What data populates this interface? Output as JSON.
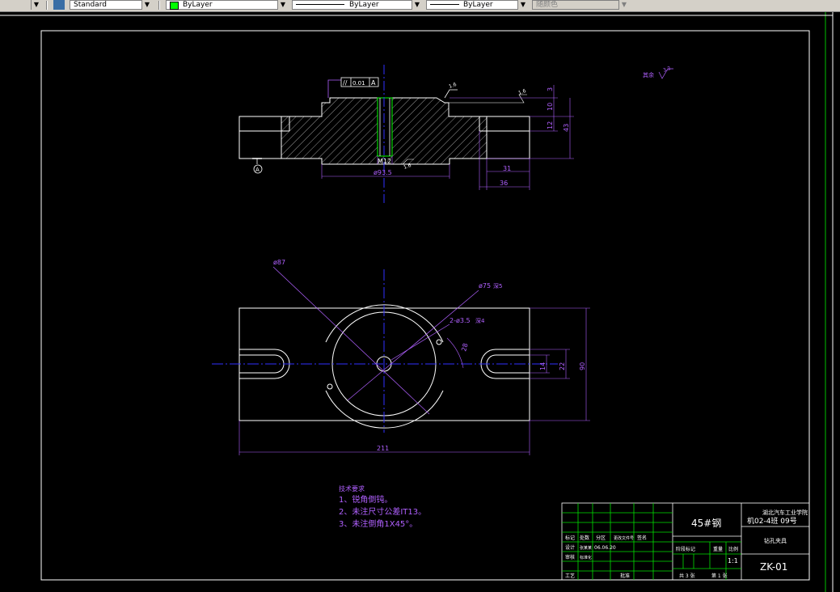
{
  "toolbar": {
    "text_style": "Standard",
    "layer_color": "ByLayer",
    "linetype": "ByLayer",
    "lineweight": "ByLayer",
    "plot_color": "随颜色",
    "arrow": "▼"
  },
  "drawing": {
    "colors": {
      "outline": "#ffffff",
      "hatch": "#ffffff",
      "dimension": "#b060ff",
      "center": "#3030ff",
      "table": "#00e000",
      "bore": "#00ff00"
    },
    "section": {
      "tolerance_symbol": "//",
      "tolerance_value": "0.01",
      "tolerance_datum": "A",
      "datum_label": "A",
      "roughness_top1": "1.6",
      "roughness_top2": "1.6",
      "roughness_bore": "1.6",
      "dim_thread": "M12",
      "dim_dia": "ø93.5",
      "dim_31": "31",
      "dim_36": "36",
      "dim_3": "3",
      "dim_10": "10",
      "dim_12": "12",
      "dim_43": "43"
    },
    "plan": {
      "dim_87": "ø87",
      "dim_75": "ø75",
      "dim_75_suffix": "深5",
      "dim_holes": "2-ø3.5",
      "dim_holes_suffix": "深4",
      "dim_28": "28",
      "dim_14": "14",
      "dim_22": "22",
      "dim_90": "90",
      "dim_211": "211"
    },
    "roughness_other": "其余",
    "roughness_other_value": "3.2",
    "tech_req": {
      "title": "技术要求",
      "items": [
        "1、锐角倒钝。",
        "2、未注尺寸公差IT13。",
        "3、未注倒角1X45°。"
      ]
    },
    "title_block": {
      "material": "45#钢",
      "school": "湖北汽车工业学院",
      "class_no": "机02-4班  09号",
      "part_name": "钻孔夹具",
      "drawing_no": "ZK-01",
      "scale": "1:1",
      "sheets_total": "共 3 张",
      "sheet_no": "第 1 张",
      "date": "06.06.20",
      "labels": {
        "mark": "标记",
        "count": "处数",
        "zone": "分区",
        "doc": "更改文件号",
        "sign": "签名",
        "design": "设计",
        "design_name": "张某某",
        "check": "审核",
        "check_name": "标准化",
        "process": "工艺",
        "approve": "批准",
        "stage": "阶段标记",
        "weight": "重量",
        "ratio": "比例"
      }
    }
  }
}
